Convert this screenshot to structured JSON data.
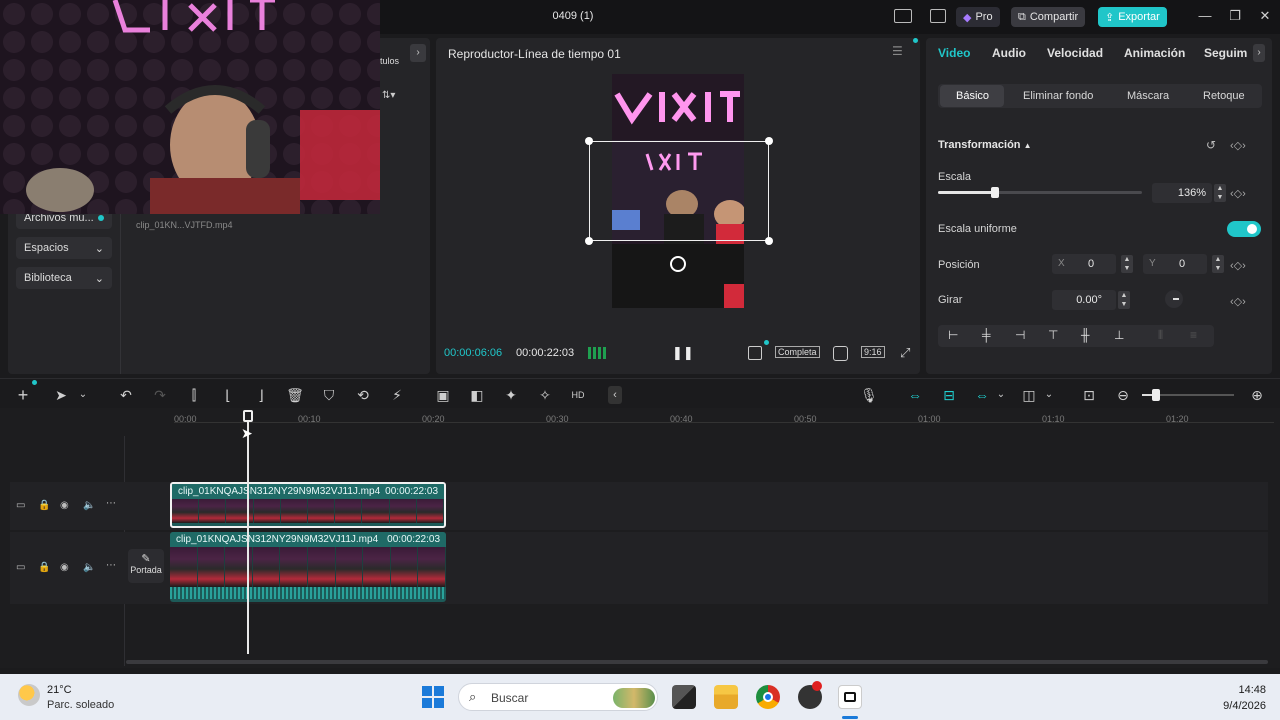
{
  "app": {
    "title": "0409 (1)",
    "pro_label": "Pro",
    "share_label": "Compartir",
    "export_label": "Exportar",
    "accent": "#20c6c9"
  },
  "media_panel": {
    "tab_partial": "tulos",
    "menu": [
      {
        "label": "Archivos mu..."
      },
      {
        "label": "Espacios"
      },
      {
        "label": "Biblioteca"
      }
    ],
    "media_item": "clip_01KN...VJTFD.mp4"
  },
  "player": {
    "title": "Reproductor-Línea de tiempo 01",
    "current_time": "00:00:06:06",
    "total_time": "00:00:22:03",
    "full_label": "Completa",
    "ratio_label": "9:16"
  },
  "inspector": {
    "tabs": [
      "Video",
      "Audio",
      "Velocidad",
      "Animación",
      "Seguim"
    ],
    "subtabs": [
      "Básico",
      "Eliminar fondo",
      "Máscara",
      "Retoque"
    ],
    "section": "Transformación",
    "scale_label": "Escala",
    "scale_value": "136%",
    "scale_level": 0.28,
    "uniform_label": "Escala uniforme",
    "position_label": "Posición",
    "pos_x_label": "X",
    "pos_x": "0",
    "pos_y_label": "Y",
    "pos_y": "0",
    "rotate_label": "Girar",
    "rotate_value": "0.00°"
  },
  "timeline": {
    "ticks": [
      "00:00",
      "00:10",
      "00:20",
      "00:30",
      "00:40",
      "00:50",
      "01:00",
      "01:10",
      "01:20"
    ],
    "clips": [
      {
        "name": "clip_01KNQAJSN312NY29N9M32VJ11J.mp4",
        "duration": "00:00:22:03"
      },
      {
        "name": "clip_01KNQAJSN312NY29N9M32VJ11J.mp4",
        "duration": "00:00:22:03"
      }
    ],
    "cover_label": "Portada"
  },
  "taskbar": {
    "temperature": "21°C",
    "weather": "Parc. soleado",
    "search_placeholder": "Buscar",
    "time": "14:48",
    "date": "9/4/2026"
  }
}
